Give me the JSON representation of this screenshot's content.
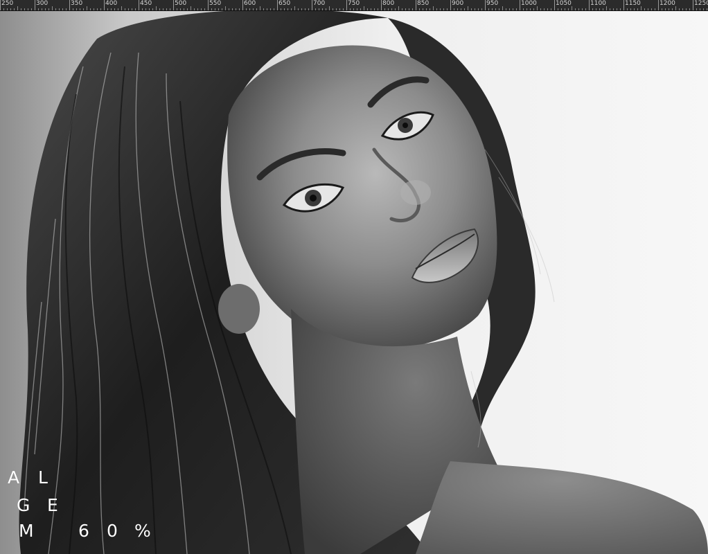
{
  "ruler": {
    "labels": [
      "250",
      "300",
      "350",
      "400",
      "450",
      "500",
      "550",
      "600",
      "650",
      "700",
      "750",
      "800",
      "850",
      "900",
      "950",
      "1000",
      "1050",
      "1100",
      "1150",
      "1200",
      "1250"
    ]
  },
  "photo": {
    "subject": "black-and-white portrait"
  },
  "overlay": {
    "row1": {
      "a": "A",
      "b": "L"
    },
    "row2": {
      "a": "G",
      "b": "E"
    },
    "row3": {
      "a": "M",
      "b": "6",
      "c": "0",
      "d": "%"
    }
  },
  "colors": {
    "ruler_bg": "#2b2b2b",
    "ruler_text": "#d6d6d6",
    "overlay_text": "#ffffff"
  }
}
